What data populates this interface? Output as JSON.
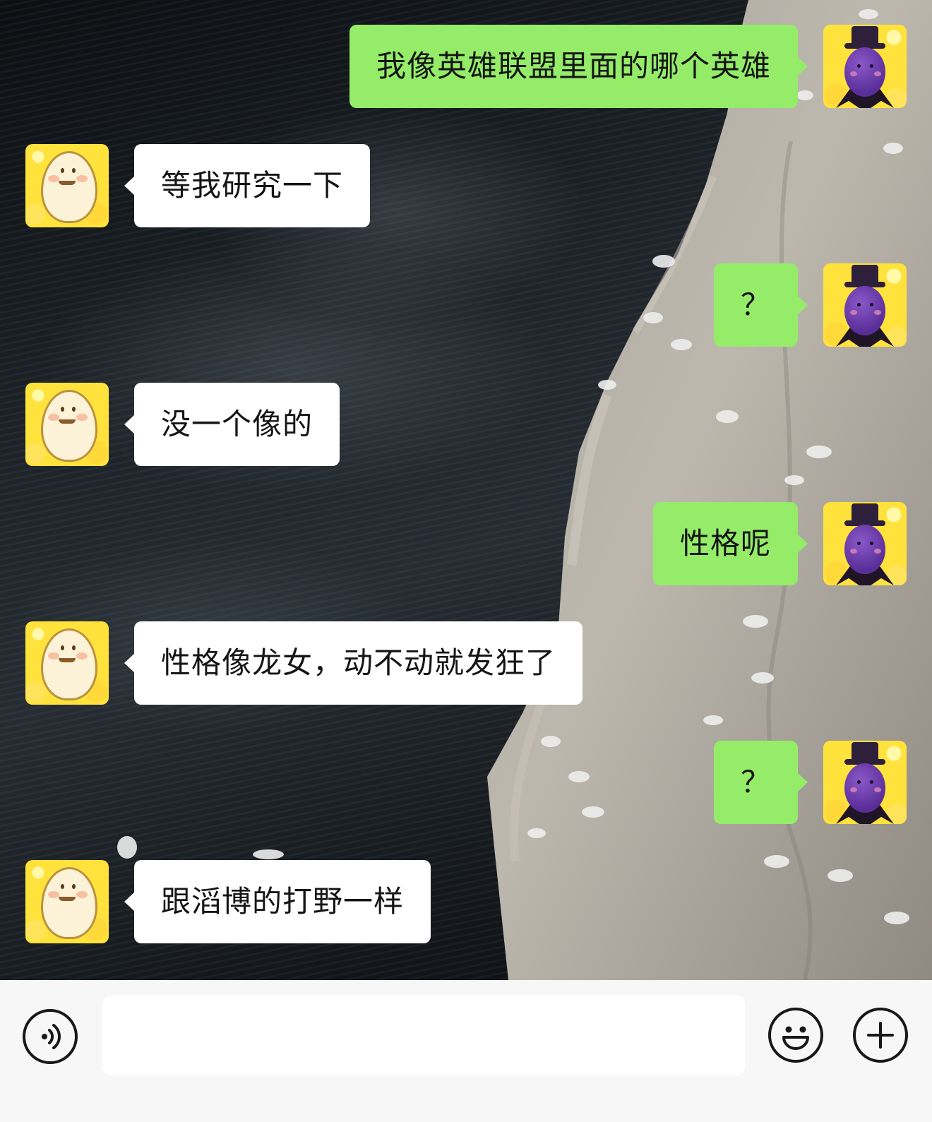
{
  "messages": [
    {
      "side": "right",
      "avatar": "plum-vampire-avatar",
      "text": "我像英雄联盟里面的哪个英雄"
    },
    {
      "side": "left",
      "avatar": "egg-avatar",
      "text": "等我研究一下"
    },
    {
      "side": "right",
      "avatar": "plum-vampire-avatar",
      "text": "？"
    },
    {
      "side": "left",
      "avatar": "egg-avatar",
      "text": "没一个像的"
    },
    {
      "side": "right",
      "avatar": "plum-vampire-avatar",
      "text": "性格呢"
    },
    {
      "side": "left",
      "avatar": "egg-avatar",
      "text": "性格像龙女，动不动就发狂了"
    },
    {
      "side": "right",
      "avatar": "plum-vampire-avatar",
      "text": "？"
    },
    {
      "side": "left",
      "avatar": "egg-avatar",
      "text": "跟滔博的打野一样"
    }
  ],
  "input_bar": {
    "input_value": "",
    "voice_icon": "voice-icon",
    "emoji_icon": "emoji-icon",
    "plus_icon": "plus-icon"
  },
  "colors": {
    "self_bubble": "#95ec69",
    "other_bubble": "#ffffff",
    "input_bar_bg": "#f7f7f7"
  }
}
